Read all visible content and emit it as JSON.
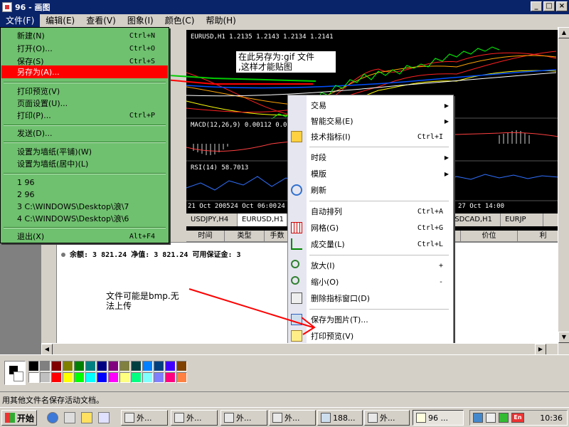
{
  "window": {
    "title": "96 - 画图"
  },
  "menubar": [
    {
      "label": "文件(F)",
      "active": true
    },
    {
      "label": "编辑(E)"
    },
    {
      "label": "查看(V)"
    },
    {
      "label": "图象(I)"
    },
    {
      "label": "颜色(C)"
    },
    {
      "label": "帮助(H)"
    }
  ],
  "file_menu": {
    "items": [
      {
        "label": "新建(N)",
        "shortcut": "Ctrl+N"
      },
      {
        "label": "打开(O)...",
        "shortcut": "Ctrl+O"
      },
      {
        "label": "保存(S)",
        "shortcut": "Ctrl+S"
      },
      {
        "label": "另存为(A)...",
        "shortcut": "",
        "highlighted": true
      },
      {
        "label": "打印预览(V)",
        "shortcut": ""
      },
      {
        "label": "页面设置(U)...",
        "shortcut": ""
      },
      {
        "label": "打印(P)...",
        "shortcut": "Ctrl+P"
      },
      {
        "label": "发送(D)...",
        "shortcut": ""
      },
      {
        "label": "设置为墙纸(平铺)(W)",
        "shortcut": ""
      },
      {
        "label": "设置为墙纸(居中)(L)",
        "shortcut": ""
      },
      {
        "label": "1 96",
        "shortcut": ""
      },
      {
        "label": "2 96",
        "shortcut": ""
      },
      {
        "label": "3 C:\\WINDOWS\\Desktop\\浪\\7",
        "shortcut": ""
      },
      {
        "label": "4 C:\\WINDOWS\\Desktop\\浪\\6",
        "shortcut": ""
      },
      {
        "label": "退出(X)",
        "shortcut": "Alt+F4"
      }
    ]
  },
  "chart": {
    "main_header": "EURUSD,H1  1.2135 1.2143 1.2134 1.2141",
    "macd_header": "MACD(12,26,9) 0.00112 0.0014",
    "rsi_header": "RSI(14) 58.7013",
    "time_labels": [
      "21 Oct 2005",
      "24 Oct 06:00",
      "24",
      "27 Oct 14:00"
    ]
  },
  "symbol_tabs": [
    "USDJPY,H4",
    "EURUSD,H1",
    "",
    "",
    "",
    "USDCAD,H1",
    "EURJP"
  ],
  "terminal": {
    "columns": [
      "时间",
      "类型",
      "手数",
      "",
      "",
      "",
      "",
      "",
      "利",
      "价位",
      "利"
    ],
    "balance_line": "余额:  3 821.24   净值:  3 821.24   可用保证金:  3"
  },
  "annotations": {
    "save_gif_note_line1": "在此另存为:gif  文件",
    "save_gif_note_line2": ",这样才能贴图",
    "bmp_note_line1": "文件可能是bmp.无",
    "bmp_note_line2": "法上传"
  },
  "context_menu": {
    "items": [
      {
        "label": "交易",
        "shortcut": "",
        "submenu": true
      },
      {
        "label": "智能交易(E)",
        "shortcut": "",
        "submenu": true
      },
      {
        "label": "技术指标(I)",
        "shortcut": "Ctrl+I",
        "icon": "indicator-icon"
      },
      {
        "label": "时段",
        "shortcut": "",
        "submenu": true
      },
      {
        "label": "模版",
        "shortcut": "",
        "submenu": true
      },
      {
        "label": "刷新",
        "shortcut": "",
        "icon": "refresh-icon"
      },
      {
        "label": "自动排列",
        "shortcut": "Ctrl+A"
      },
      {
        "label": "网格(G)",
        "shortcut": "Ctrl+G",
        "icon": "grid-icon"
      },
      {
        "label": "成交量(L)",
        "shortcut": "Ctrl+L",
        "icon": "volume-icon"
      },
      {
        "label": "放大(I)",
        "shortcut": "+",
        "icon": "zoom-in-icon"
      },
      {
        "label": "缩小(O)",
        "shortcut": "-",
        "icon": "zoom-out-icon"
      },
      {
        "label": "删除指标窗口(D)",
        "shortcut": "",
        "icon": "delete-indicator-icon"
      },
      {
        "label": "保存为图片(T)...",
        "shortcut": "",
        "icon": "save-picture-icon"
      },
      {
        "label": "打印预览(V)",
        "shortcut": "",
        "icon": "print-preview-icon"
      }
    ]
  },
  "palette_colors": [
    "#000000",
    "#808080",
    "#800000",
    "#808000",
    "#008000",
    "#008080",
    "#000080",
    "#800080",
    "#808040",
    "#004040",
    "#0080ff",
    "#004080",
    "#4000ff",
    "#804000",
    "#ffffff",
    "#c0c0c0",
    "#ff0000",
    "#ffff00",
    "#00ff00",
    "#00ffff",
    "#0000ff",
    "#ff00ff",
    "#ffff80",
    "#00ff80",
    "#80ffff",
    "#8080ff",
    "#ff0080",
    "#ff8040"
  ],
  "statusbar": {
    "text": "用其他文件名保存活动文档。"
  },
  "taskbar": {
    "start_label": "开始",
    "buttons": [
      {
        "label": "外...",
        "active": false
      },
      {
        "label": "外...",
        "active": false
      },
      {
        "label": "外...",
        "active": false
      },
      {
        "label": "外...",
        "active": false
      },
      {
        "label": "188...",
        "active": false
      },
      {
        "label": "外...",
        "active": false
      },
      {
        "label": "96 ...",
        "active": true
      }
    ],
    "clock": "10:36",
    "lang_indicator": "En"
  }
}
